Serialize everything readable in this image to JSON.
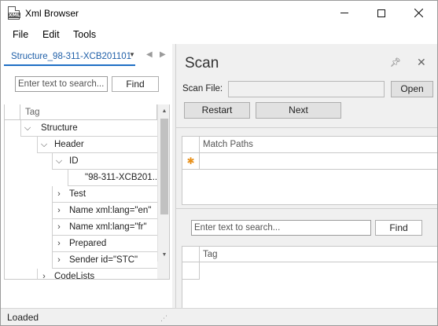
{
  "window": {
    "title": "Xml Browser",
    "icon": "xml-file-icon",
    "icon_text": "XML"
  },
  "menu": {
    "items": [
      "File",
      "Edit",
      "Tools"
    ]
  },
  "left": {
    "tab_label": "Structure_98-311-XCB201101",
    "search_placeholder": "Enter text to search...",
    "find_label": "Find",
    "tree_header": "Tag",
    "tree": [
      {
        "label": "Structure",
        "glyph": "⌵"
      },
      {
        "label": "Header",
        "glyph": "⌵"
      },
      {
        "label": "ID",
        "glyph": "⌵"
      },
      {
        "label": "\"98-311-XCB201...",
        "glyph": ""
      },
      {
        "label": "Test",
        "glyph": "›"
      },
      {
        "label": "Name xml:lang=\"en\"",
        "glyph": "›"
      },
      {
        "label": "Name xml:lang=\"fr\"",
        "glyph": "›"
      },
      {
        "label": "Prepared",
        "glyph": "›"
      },
      {
        "label": "Sender id=\"STC\"",
        "glyph": "›"
      },
      {
        "label": "CodeLists",
        "glyph": "›"
      }
    ]
  },
  "status": {
    "text": "Loaded"
  },
  "scan": {
    "title": "Scan",
    "scan_file_label": "Scan File:",
    "scan_file_value": "",
    "open_label": "Open",
    "restart_label": "Restart",
    "next_label": "Next",
    "match_paths_header": "Match Paths",
    "new_row_marker": "✱",
    "search_placeholder": "Enter text to search...",
    "find_label": "Find",
    "tag_header": "Tag"
  }
}
